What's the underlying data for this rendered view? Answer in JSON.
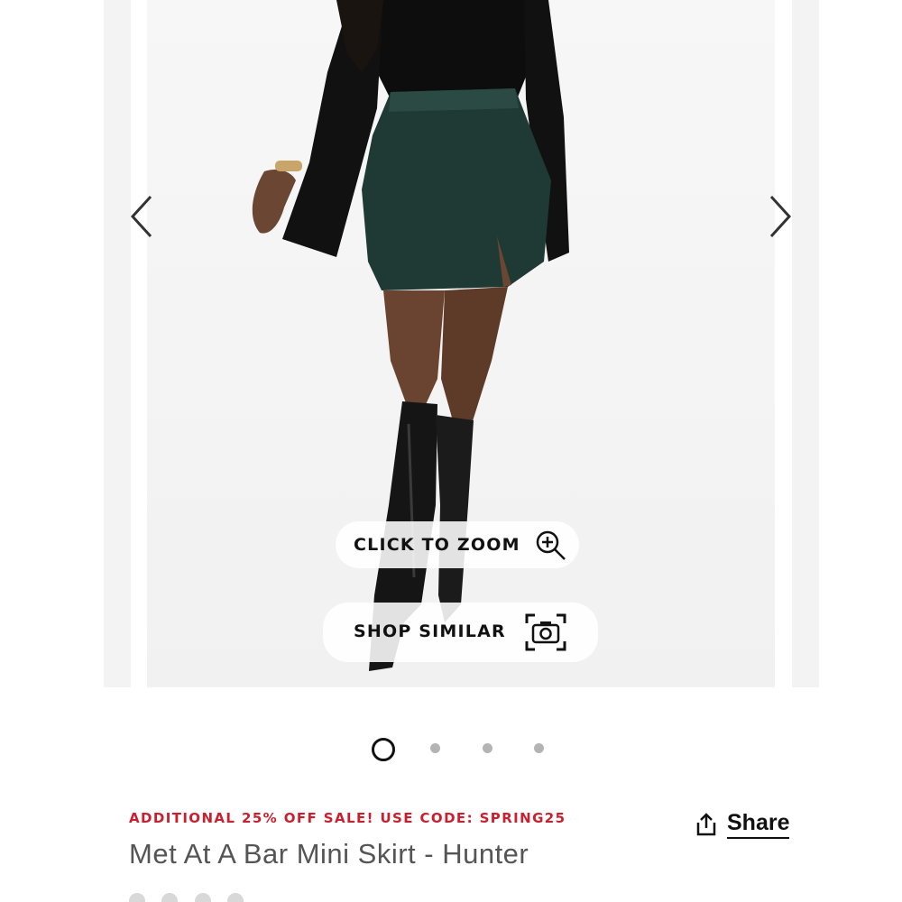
{
  "gallery": {
    "zoom_label": "CLICK TO ZOOM",
    "similar_label": "SHOP SIMILAR",
    "image_count": 4,
    "active_index": 0
  },
  "product": {
    "promo": "ADDITIONAL 25% OFF SALE! USE CODE: SPRING25",
    "title": "Met At A Bar Mini Skirt - Hunter",
    "share_label": "Share"
  },
  "colors": {
    "promo": "#c8202f",
    "title": "#555555",
    "skirt": "#1f3a34"
  },
  "icons": [
    "chevron-left-icon",
    "chevron-right-icon",
    "zoom-in-icon",
    "camera-icon",
    "share-icon",
    "star-icon"
  ]
}
